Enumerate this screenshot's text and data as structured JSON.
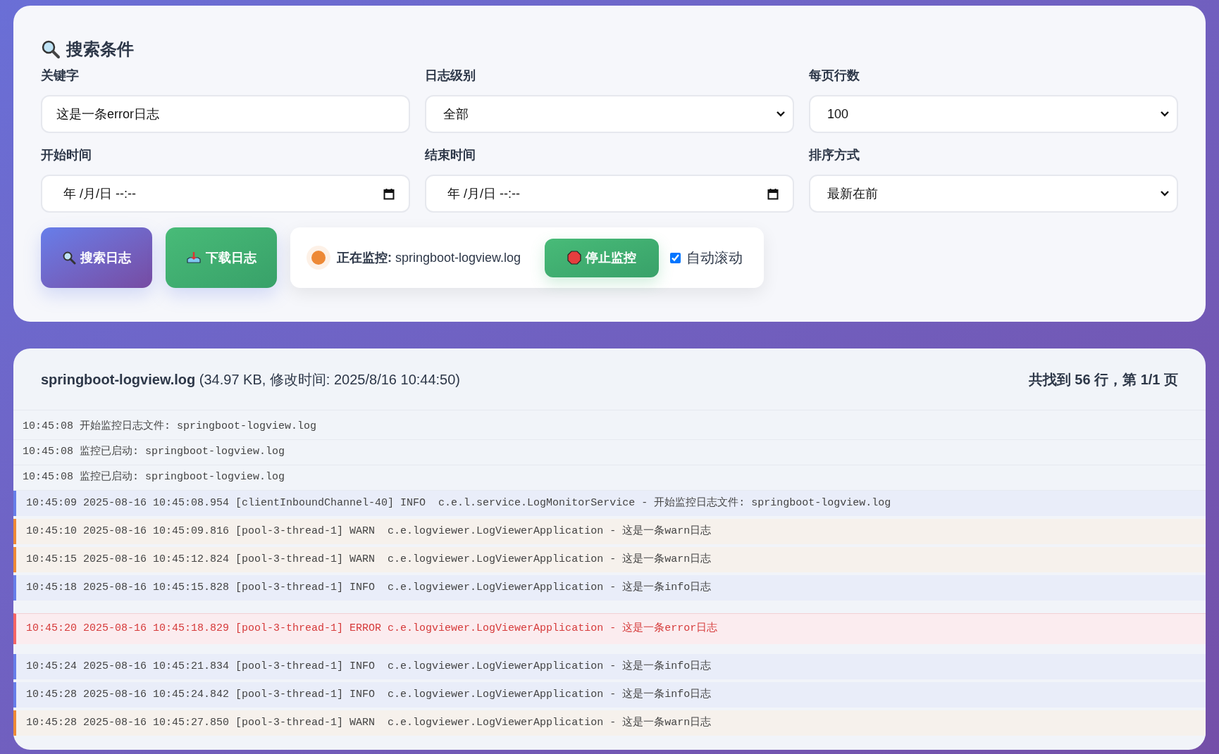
{
  "search_panel": {
    "title": "搜索条件",
    "fields": [
      {
        "kind": "text",
        "label": "关键字",
        "value": "这是一条error日志"
      },
      {
        "kind": "select",
        "label": "日志级别",
        "value": "全部"
      },
      {
        "kind": "select",
        "label": "每页行数",
        "value": "100"
      },
      {
        "kind": "datetime",
        "label": "开始时间",
        "value": "年 /月/日 --:--"
      },
      {
        "kind": "datetime",
        "label": "结束时间",
        "value": "年 /月/日 --:--"
      },
      {
        "kind": "select",
        "label": "排序方式",
        "value": "最新在前"
      }
    ],
    "buttons": [
      {
        "kind": "search",
        "label": "搜索日志"
      },
      {
        "kind": "download",
        "label": "下载日志"
      }
    ],
    "monitor": {
      "active": true,
      "label": "正在监控:",
      "file": "springboot-logview.log",
      "stop_button": "停止监控",
      "auto_scroll": {
        "label": "自动滚动",
        "checked": true
      }
    }
  },
  "log_panel": {
    "file_name": "springboot-logview.log",
    "file_info": "(34.97 KB, 修改时间: 2025/8/16 10:44:50)",
    "summary": "共找到 56 行，第 1/1 页",
    "lines": [
      {
        "kind": "system",
        "time": "10:45:08",
        "text": "开始监控日志文件: springboot-logview.log"
      },
      {
        "kind": "system",
        "time": "10:45:08",
        "text": "监控已启动: springboot-logview.log"
      },
      {
        "kind": "system",
        "time": "10:45:08",
        "text": "监控已启动: springboot-logview.log"
      },
      {
        "kind": "info",
        "time": "10:45:09",
        "text": "2025-08-16 10:45:08.954 [clientInboundChannel-40] INFO  c.e.l.service.LogMonitorService - 开始监控日志文件: springboot-logview.log"
      },
      {
        "kind": "warn",
        "time": "10:45:10",
        "text": "2025-08-16 10:45:09.816 [pool-3-thread-1] WARN  c.e.logviewer.LogViewerApplication - 这是一条warn日志"
      },
      {
        "kind": "warn",
        "time": "10:45:15",
        "text": "2025-08-16 10:45:12.824 [pool-3-thread-1] WARN  c.e.logviewer.LogViewerApplication - 这是一条warn日志"
      },
      {
        "kind": "info",
        "time": "10:45:18",
        "text": "2025-08-16 10:45:15.828 [pool-3-thread-1] INFO  c.e.logviewer.LogViewerApplication - 这是一条info日志"
      },
      {
        "kind": "error",
        "time": "10:45:20",
        "text": "2025-08-16 10:45:18.829 [pool-3-thread-1] ERROR c.e.logviewer.LogViewerApplication - 这是一条error日志"
      },
      {
        "kind": "info",
        "time": "10:45:24",
        "text": "2025-08-16 10:45:21.834 [pool-3-thread-1] INFO  c.e.logviewer.LogViewerApplication - 这是一条info日志"
      },
      {
        "kind": "info",
        "time": "10:45:28",
        "text": "2025-08-16 10:45:24.842 [pool-3-thread-1] INFO  c.e.logviewer.LogViewerApplication - 这是一条info日志"
      },
      {
        "kind": "warn",
        "time": "10:45:28",
        "text": "2025-08-16 10:45:27.850 [pool-3-thread-1] WARN  c.e.logviewer.LogViewerApplication - 这是一条warn日志"
      }
    ]
  }
}
